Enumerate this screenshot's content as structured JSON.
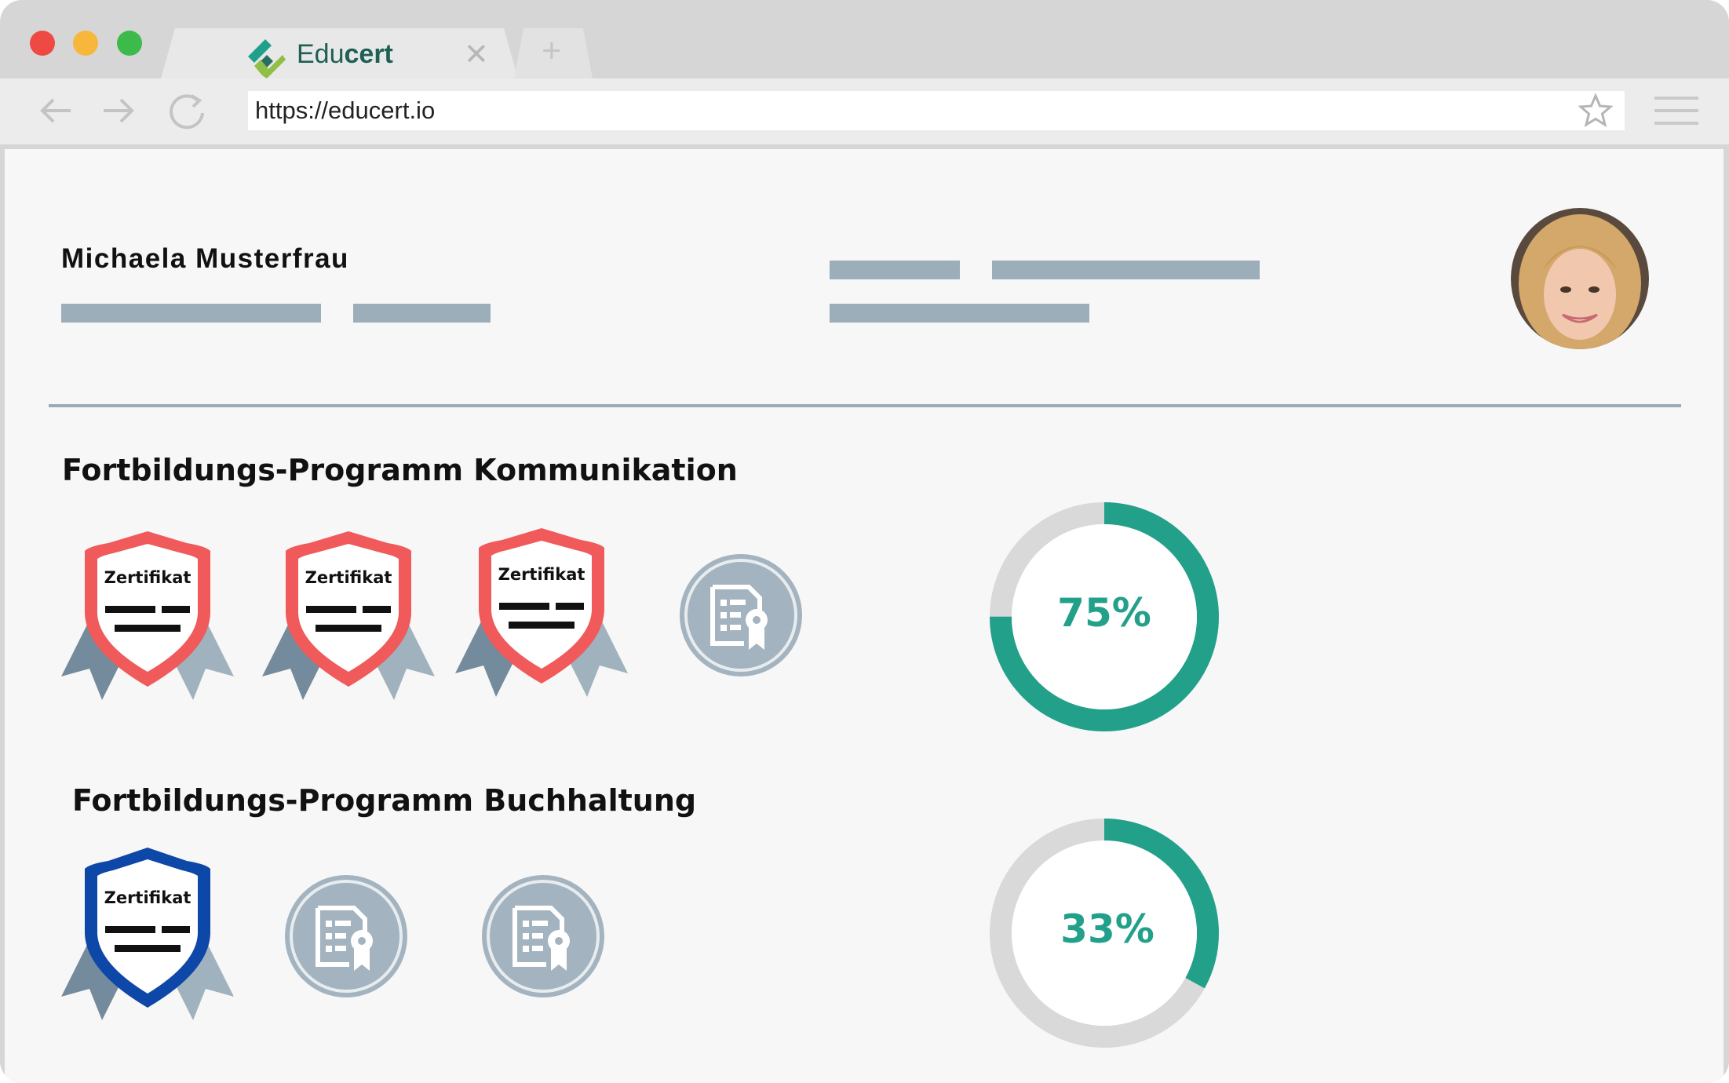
{
  "browser": {
    "tab_title_light": "Edu",
    "tab_title_bold": "cert",
    "close_glyph": "✕",
    "newtab_glyph": "+",
    "url": "https://educert.io",
    "traffic_lights": [
      "#ee4a43",
      "#f6b73c",
      "#3cba4a"
    ]
  },
  "profile": {
    "name": "Michaela Musterfrau"
  },
  "programs": [
    {
      "title": "Fortbildungs-Programm Kommunikation",
      "certificates": [
        {
          "label": "Zertifikat",
          "status": "earned",
          "color": "#f05a5a"
        },
        {
          "label": "Zertifikat",
          "status": "earned",
          "color": "#f05a5a"
        },
        {
          "label": "Zertifikat",
          "status": "earned",
          "color": "#f05a5a"
        },
        {
          "status": "locked",
          "icon": "certificate-icon"
        }
      ],
      "progress": {
        "value": 75,
        "label": "75%"
      }
    },
    {
      "title": "Fortbildungs-Programm Buchhaltung",
      "certificates": [
        {
          "label": "Zertifikat",
          "status": "earned",
          "color": "#0d47a8"
        },
        {
          "status": "locked",
          "icon": "certificate-icon"
        },
        {
          "status": "locked",
          "icon": "certificate-icon"
        }
      ],
      "progress": {
        "value": 33,
        "label": "33%"
      }
    }
  ],
  "colors": {
    "progress_fill": "#22a08a",
    "progress_track": "#d9d9d9",
    "placeholder_bar": "#9caeba",
    "ribbon_dark": "#738b9c",
    "ribbon_light": "#a0b2be",
    "locked_circle": "#a3b3bf"
  }
}
